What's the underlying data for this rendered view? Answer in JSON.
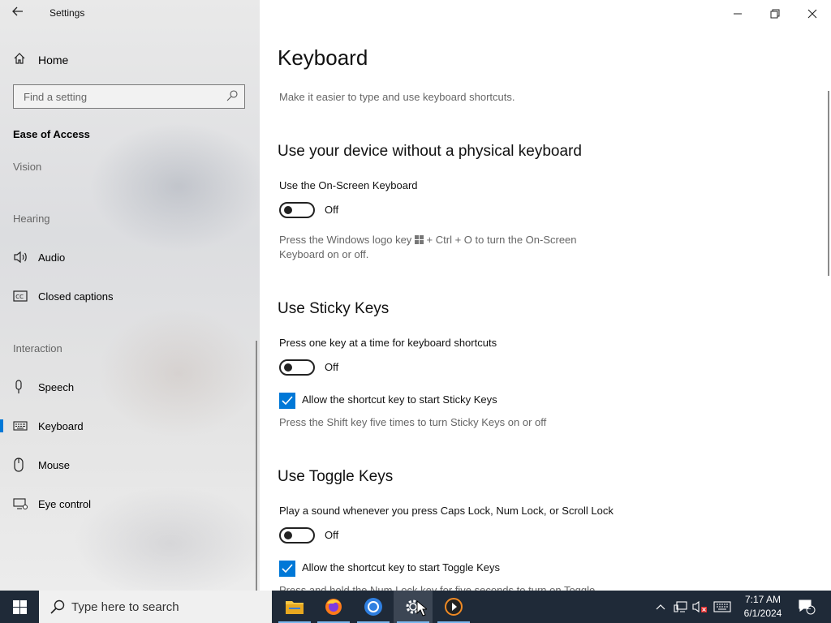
{
  "window": {
    "app_title": "Settings"
  },
  "sidebar": {
    "home_label": "Home",
    "search_placeholder": "Find a setting",
    "section_title": "Ease of Access",
    "groups": {
      "vision": "Vision",
      "hearing": "Hearing",
      "interaction": "Interaction"
    },
    "items": [
      {
        "label": "Audio",
        "icon": "speaker-icon"
      },
      {
        "label": "Closed captions",
        "icon": "cc-icon"
      },
      {
        "label": "Speech",
        "icon": "microphone-icon"
      },
      {
        "label": "Keyboard",
        "icon": "keyboard-icon",
        "active": true
      },
      {
        "label": "Mouse",
        "icon": "mouse-icon"
      },
      {
        "label": "Eye control",
        "icon": "eye-control-icon"
      }
    ]
  },
  "main": {
    "title": "Keyboard",
    "description": "Make it easier to type and use keyboard shortcuts.",
    "osk": {
      "heading": "Use your device without a physical keyboard",
      "option_label": "Use the On-Screen Keyboard",
      "toggle_state": "Off",
      "hint_part1": "Press the Windows logo key",
      "hint_part2": "+ Ctrl + O to turn the On-Screen",
      "hint_line2": "Keyboard on or off."
    },
    "sticky": {
      "heading": "Use Sticky Keys",
      "option_label": "Press one key at a time for keyboard shortcuts",
      "toggle_state": "Off",
      "checkbox_label": "Allow the shortcut key to start Sticky Keys",
      "hint": "Press the Shift key five times to turn Sticky Keys on or off"
    },
    "toggle_keys": {
      "heading": "Use Toggle Keys",
      "option_label": "Play a sound whenever you press Caps Lock, Num Lock, or Scroll Lock",
      "toggle_state": "Off",
      "checkbox_label": "Allow the shortcut key to start Toggle Keys",
      "hint": "Press and hold the Num Lock key for five seconds to turn on Toggle"
    }
  },
  "taskbar": {
    "search_placeholder": "Type here to search",
    "apps": [
      "file-explorer-icon",
      "firefox-icon",
      "chrome-icon",
      "settings-icon",
      "media-player-icon"
    ],
    "clock_time": "7:17 AM",
    "clock_date": "6/1/2024",
    "notification_count": "2"
  },
  "colors": {
    "accent": "#0078d7",
    "taskbar": "#1f2a38"
  }
}
